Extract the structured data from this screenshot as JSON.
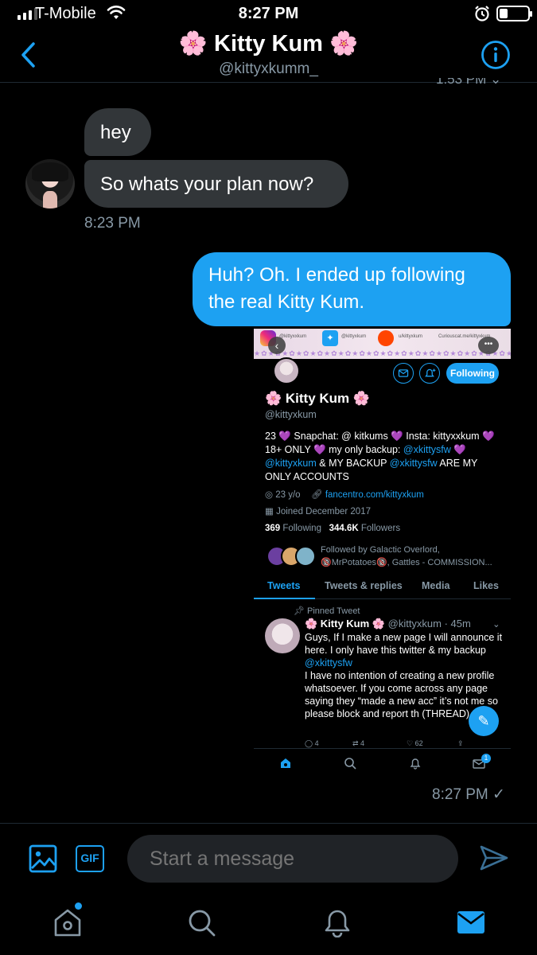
{
  "status_bar": {
    "carrier": "T-Mobile",
    "time": "8:27 PM"
  },
  "header": {
    "title": "🌸 Kitty Kum 🌸",
    "handle": "@kittyxkumm_",
    "partial_timestamp": "1:53 PM ⌄"
  },
  "messages": [
    {
      "text": "hey"
    },
    {
      "text": "So whats your plan now?"
    },
    {
      "text": "Huh? Oh. I ended up following the real Kitty Kum."
    }
  ],
  "time_received": "8:23 PM",
  "time_sent": "8:27 PM ✓",
  "embedded_profile": {
    "banner": {
      "ig": "@kittyxxkum",
      "tw": "@kittyxkum",
      "rd": "u/kittyxkum",
      "cc": "Curiouscat.me/kittyxkum"
    },
    "follow_label": "Following",
    "name": "🌸 Kitty Kum 🌸",
    "handle": "@kittyxkum",
    "bio_part1": "23 💜 Snapchat: @ kitkums 💜 Insta: kittyxxkum 💜 18+ ONLY 💜 my only backup: ",
    "bio_link1": "@xkittysfw",
    "bio_part2": " 💜 ",
    "bio_link2": "@kittyxkum",
    "bio_part3": " & MY BACKUP ",
    "bio_link3": "@xkittysfw",
    "bio_part4": " ARE MY ONLY ACCOUNTS",
    "age": "23 y/o",
    "link": "fancentro.com/kittyxkum",
    "joined": "Joined December 2017",
    "following_count": "369",
    "following_label": "Following",
    "followers_count": "344.6K",
    "followers_label": "Followers",
    "followed_by": "Followed by Galactic Overlord,",
    "followed_by_2": "🔞MrPotatoes🔞, Gattles - COMMISSION...",
    "tabs": [
      "Tweets",
      "Tweets & replies",
      "Media",
      "Likes"
    ],
    "pinned_label": "Pinned Tweet",
    "tweet_name": "🌸 Kitty Kum 🌸",
    "tweet_meta": "@kittyxkum · 45m",
    "tweet_body_1": "Guys, If I make a new page I will announce it here. I only have this twitter & my backup ",
    "tweet_body_link": "@xkittysfw",
    "tweet_body_2": "I have no intention of creating a new profile whatsoever. If you come across any page saying they “made a new acc” it’s not me so please block and report th (THREAD)",
    "tweet_replies": "4",
    "tweet_retweets": "4",
    "tweet_likes": "62",
    "nav_badge": "1"
  },
  "composer": {
    "placeholder": "Start a message",
    "gif_label": "GIF"
  },
  "colors": {
    "accent": "#1da1f2",
    "bubble_in": "#323639",
    "muted": "#8899a6"
  }
}
